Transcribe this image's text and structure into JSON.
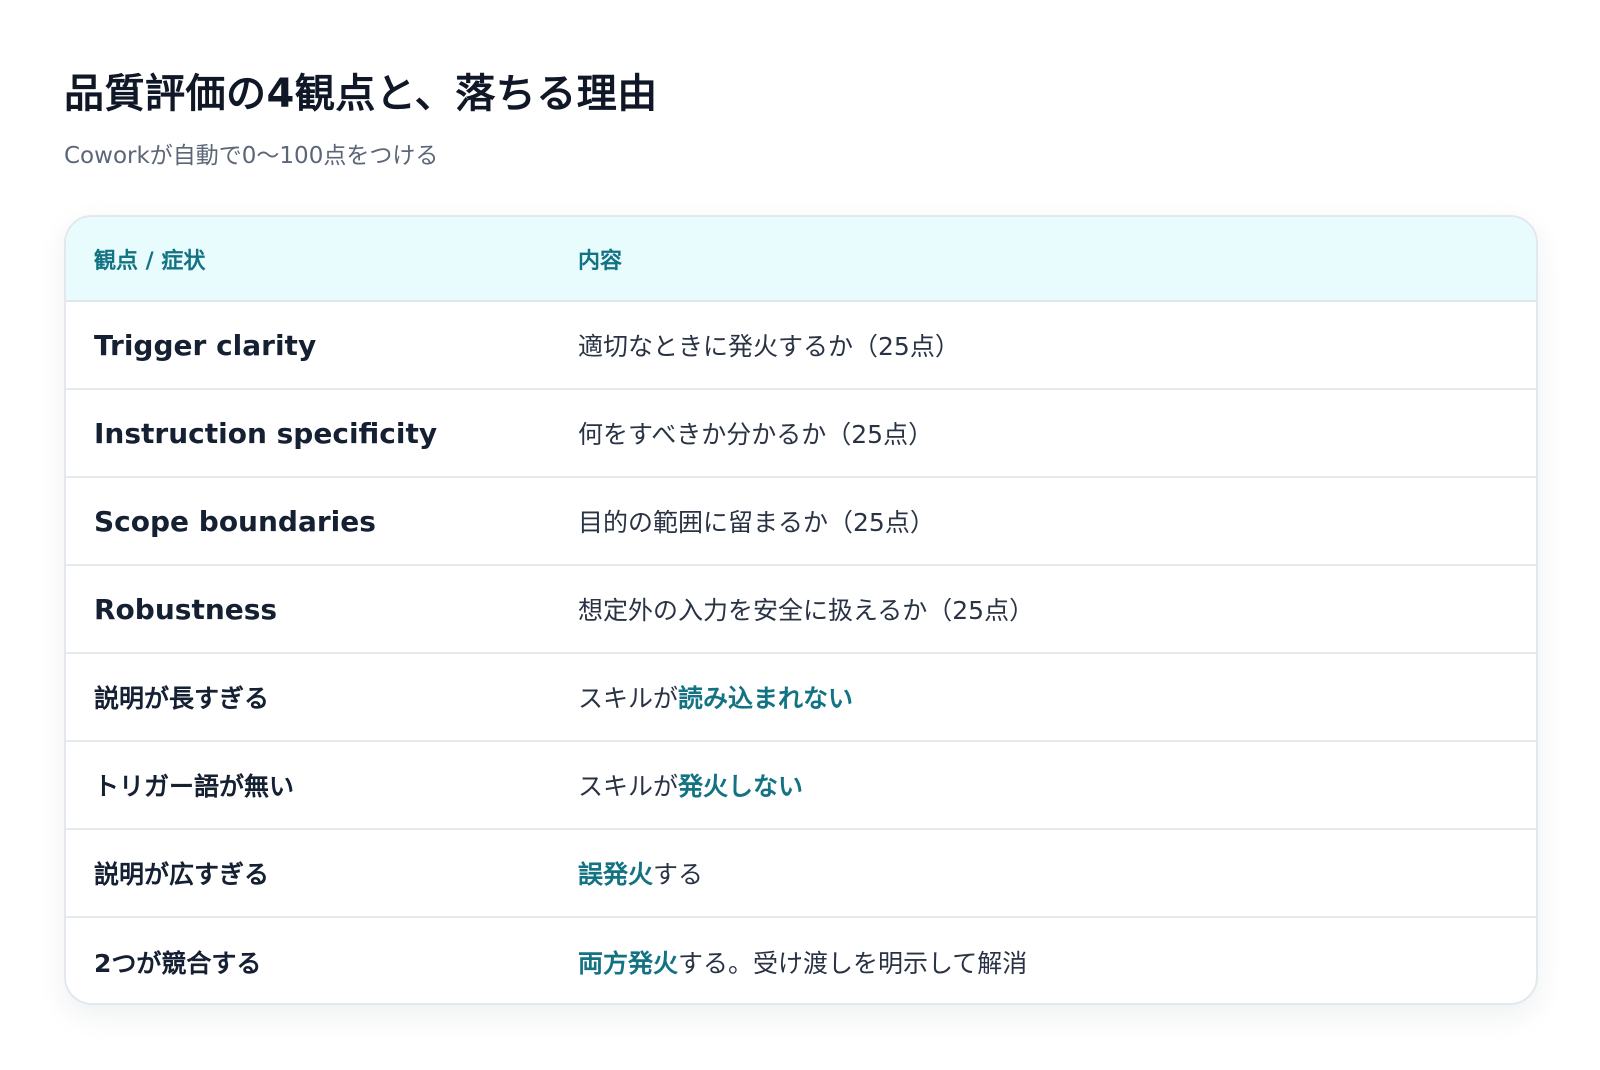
{
  "header": {
    "title": "品質評価の4観点と、落ちる理由",
    "subtitle": "Coworkが自動で0〜100点をつける"
  },
  "table": {
    "columns": [
      "観点 / 症状",
      "内容"
    ],
    "rows": [
      {
        "aspect": "Trigger clarity",
        "desc_pre": "適切なときに発火するか（25点）",
        "desc_hl": "",
        "desc_post": ""
      },
      {
        "aspect": "Instruction specificity",
        "desc_pre": "何をすべきか分かるか（25点）",
        "desc_hl": "",
        "desc_post": ""
      },
      {
        "aspect": "Scope boundaries",
        "desc_pre": "目的の範囲に留まるか（25点）",
        "desc_hl": "",
        "desc_post": ""
      },
      {
        "aspect": "Robustness",
        "desc_pre": "想定外の入力を安全に扱えるか（25点）",
        "desc_hl": "",
        "desc_post": ""
      },
      {
        "aspect": "説明が長すぎる",
        "desc_pre": "スキルが",
        "desc_hl": "読み込まれない",
        "desc_post": ""
      },
      {
        "aspect": "トリガー語が無い",
        "desc_pre": "スキルが",
        "desc_hl": "発火しない",
        "desc_post": ""
      },
      {
        "aspect": "説明が広すぎる",
        "desc_pre": "",
        "desc_hl": "誤発火",
        "desc_post": "する"
      },
      {
        "aspect": "2つが競合する",
        "desc_pre": "",
        "desc_hl": "両方発火",
        "desc_post": "する。受け渡しを明示して解消"
      }
    ]
  },
  "colors": {
    "accent": "#137383",
    "header_bg": "#e9fcfd",
    "border": "#e3e8ee",
    "title_text": "#101827",
    "subtitle_text": "#5b6676"
  }
}
